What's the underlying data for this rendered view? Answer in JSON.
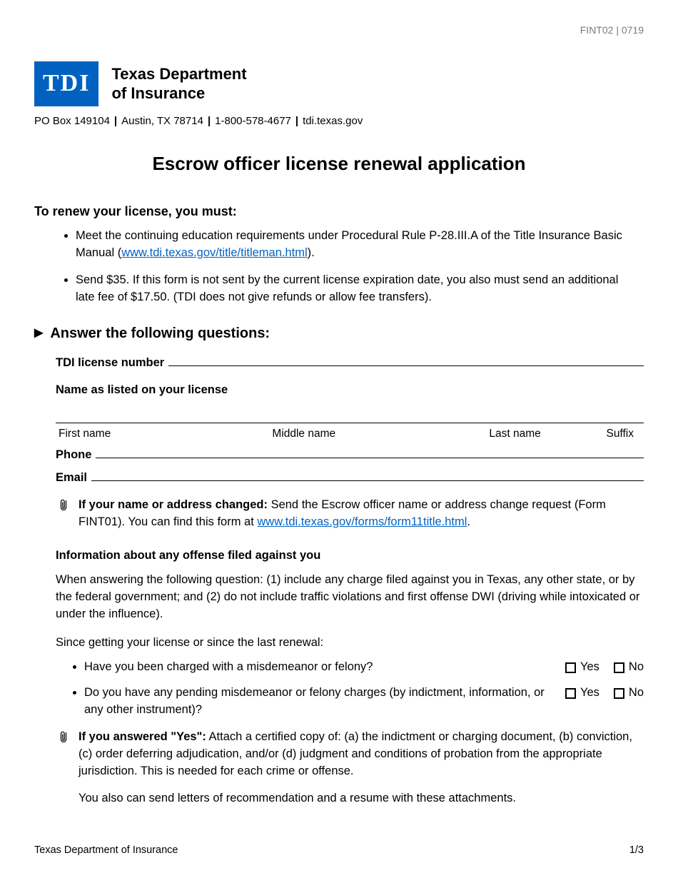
{
  "meta": {
    "form_id": "FINT02 | 0719"
  },
  "header": {
    "logo_text": "TDI",
    "dept_line1": "Texas Department",
    "dept_line2": "of Insurance",
    "contact": {
      "po": "PO Box 149104",
      "city": "Austin, TX 78714",
      "phone": "1-800-578-4677",
      "site": "tdi.texas.gov"
    }
  },
  "title": "Escrow officer license renewal application",
  "renew": {
    "lead": "To renew your license, you must:",
    "b1_pre": "Meet the continuing education requirements under Procedural Rule P-28.III.A of the Title Insurance Basic Manual (",
    "b1_link": "www.tdi.texas.gov/title/titleman.html",
    "b1_post": ").",
    "b2": "Send $35. If this form is not sent by the current license expiration date, you also must send an additional late fee of $17.50. (TDI does not give refunds or allow fee transfers)."
  },
  "questions": {
    "heading": "Answer the following questions:",
    "license_lbl": "TDI license number",
    "name_lbl": "Name as listed on your license",
    "cols": {
      "first": "First name",
      "middle": "Middle name",
      "last": "Last name",
      "suffix": "Suffix"
    },
    "phone_lbl": "Phone",
    "email_lbl": "Email",
    "change_note_lead": "If your name or address changed:",
    "change_note_body_pre": " Send the Escrow officer name or address change request (Form FINT01). You can find this form at ",
    "change_note_link": "www.tdi.texas.gov/forms/form11title.html",
    "change_note_body_post": "."
  },
  "offense": {
    "subhead": "Information about any offense filed against you",
    "para1": "When answering the following question: (1) include any charge filed against you in Texas, any other state, or by the federal government; and (2) do not include traffic violations and first offense DWI (driving while intoxicated or under the influence).",
    "para2": "Since getting your license or since the last renewal:",
    "q1": "Have you been charged with a misdemeanor or felony?",
    "q2": "Do you have any pending misdemeanor or felony charges (by indictment, information, or any other instrument)?",
    "yes": "Yes",
    "no": "No",
    "yes_note_lead": "If you answered \"Yes\":",
    "yes_note_body": " Attach a certified copy of: (a) the indictment or charging document, (b) conviction, (c) order deferring adjudication, and/or (d) judgment and conditions of probation from the appropriate jurisdiction. This is needed for each crime or offense.",
    "yes_note_follow": "You also can send letters of recommendation and a resume with these attachments."
  },
  "footer": {
    "org": "Texas Department of Insurance",
    "page": "1/3"
  }
}
